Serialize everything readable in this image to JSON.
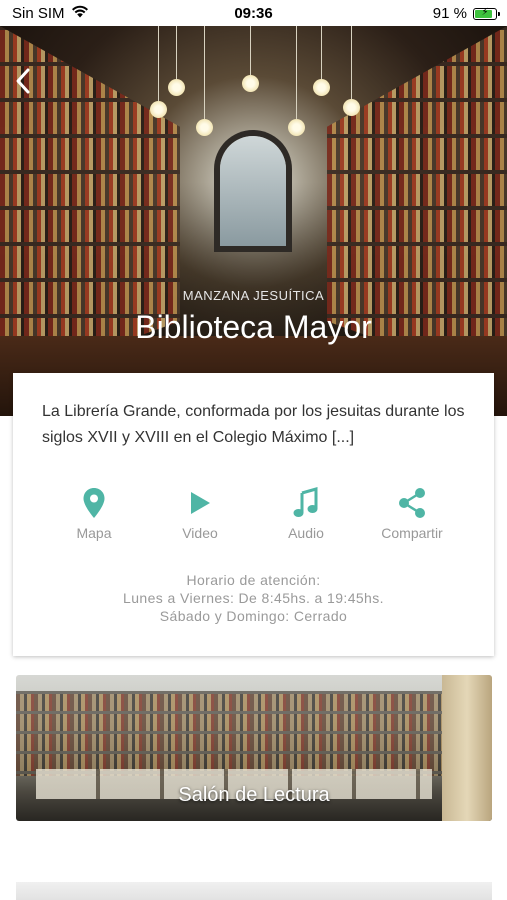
{
  "status_bar": {
    "carrier": "Sin SIM",
    "time": "09:36",
    "battery_percent": "91 %",
    "battery_level": 0.91,
    "wifi_icon": "wifi-icon",
    "battery_icon": "battery-charging-icon"
  },
  "hero": {
    "subtitle": "MANZANA JESUÍTICA",
    "title": "Biblioteca Mayor",
    "back_icon": "chevron-left-icon"
  },
  "info": {
    "description": "La Librería Grande, conformada por los jesuitas durante los siglos XVII y XVIII en el Colegio Máximo [...]",
    "actions": [
      {
        "label": "Mapa",
        "icon": "map-pin-icon"
      },
      {
        "label": "Video",
        "icon": "play-icon"
      },
      {
        "label": "Audio",
        "icon": "music-note-icon"
      },
      {
        "label": "Compartir",
        "icon": "share-icon"
      }
    ],
    "hours": {
      "title": "Horario de atención:",
      "weekdays": "Lunes a Viernes: De 8:45hs. a 19:45hs.",
      "weekend": "Sábado y Domingo: Cerrado"
    }
  },
  "rooms": [
    {
      "title": "Salón de Lectura"
    }
  ],
  "colors": {
    "accent": "#4fb5a5",
    "label_gray": "#999999",
    "text_dark": "#333333"
  }
}
